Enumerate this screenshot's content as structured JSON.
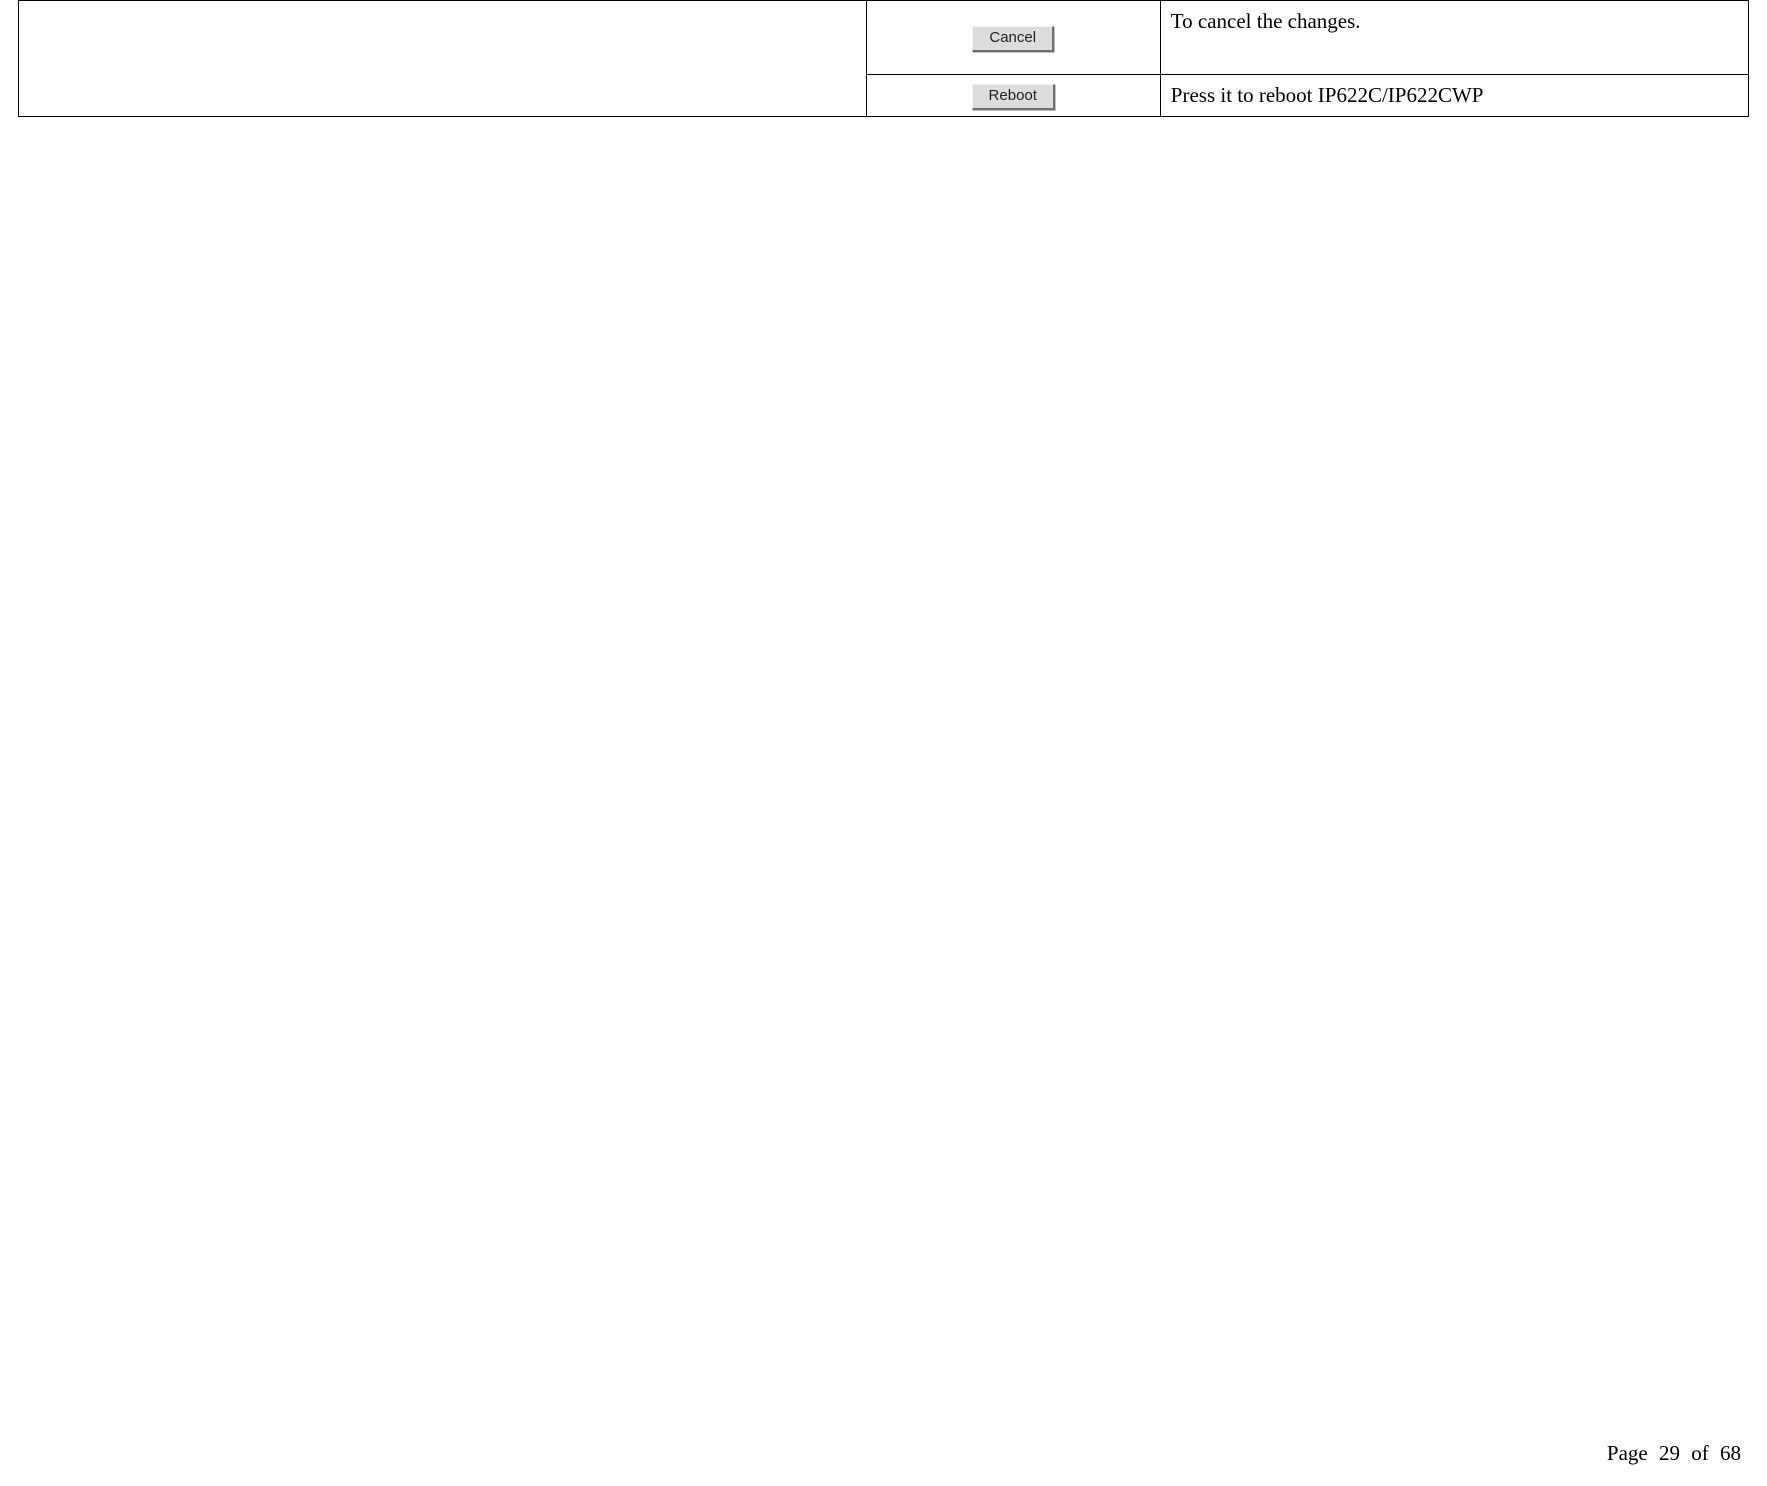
{
  "table": {
    "rows": [
      {
        "button_label": "Cancel",
        "description": "To cancel the changes."
      },
      {
        "button_label": "Reboot",
        "description": "Press it to reboot IP622C/IP622CWP"
      }
    ]
  },
  "footer": {
    "text": "Page 29 of 68"
  }
}
